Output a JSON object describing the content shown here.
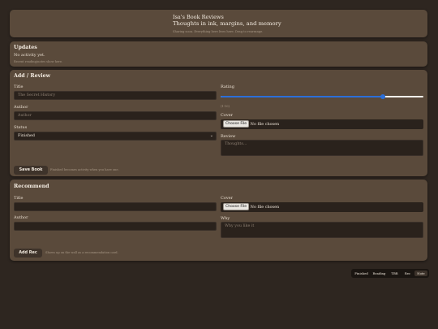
{
  "header": {
    "title": "Isa's Book Reviews",
    "subtitle": "Thoughts in ink, margins, and memory",
    "hint": "Sharing soon. Everything here lives here. Drag to rearrange."
  },
  "updates": {
    "heading": "Updates",
    "status": "No activity yet.",
    "hint": "Recent reading/notes show here."
  },
  "add_review": {
    "heading": "Add / Review",
    "title_label": "Title",
    "title_placeholder": "The Secret History",
    "author_label": "Author",
    "author_placeholder": "Author",
    "status_label": "Status",
    "status_value": "Finished",
    "rating_label": "Rating",
    "rating_value": 0.8,
    "rating_hint": "(1-10)",
    "cover_label": "Cover",
    "file_button": "Choose File",
    "file_status": "No file chosen",
    "review_label": "Review",
    "review_placeholder": "Thoughts...",
    "save_button": "Save Book",
    "save_hint": "Finished becomes activity when you have one."
  },
  "recommend": {
    "heading": "Recommend",
    "title_label": "Title",
    "author_label": "Author",
    "cover_label": "Cover",
    "file_button": "Choose File",
    "file_status": "No file chosen",
    "why_label": "Why",
    "why_placeholder": "Why you like it",
    "add_button": "Add Rec",
    "add_hint": "Shows up on the wall as a recommendation card."
  },
  "tabs": [
    {
      "label": "Finished",
      "active": false
    },
    {
      "label": "Reading",
      "active": false
    },
    {
      "label": "TBR",
      "active": false
    },
    {
      "label": "Rec",
      "active": false
    },
    {
      "label": "Note",
      "active": true
    }
  ],
  "colors": {
    "background": "#2e2620",
    "panel": "#5a4a3b",
    "field": "#2a221c",
    "accent": "#2c6fd9"
  }
}
